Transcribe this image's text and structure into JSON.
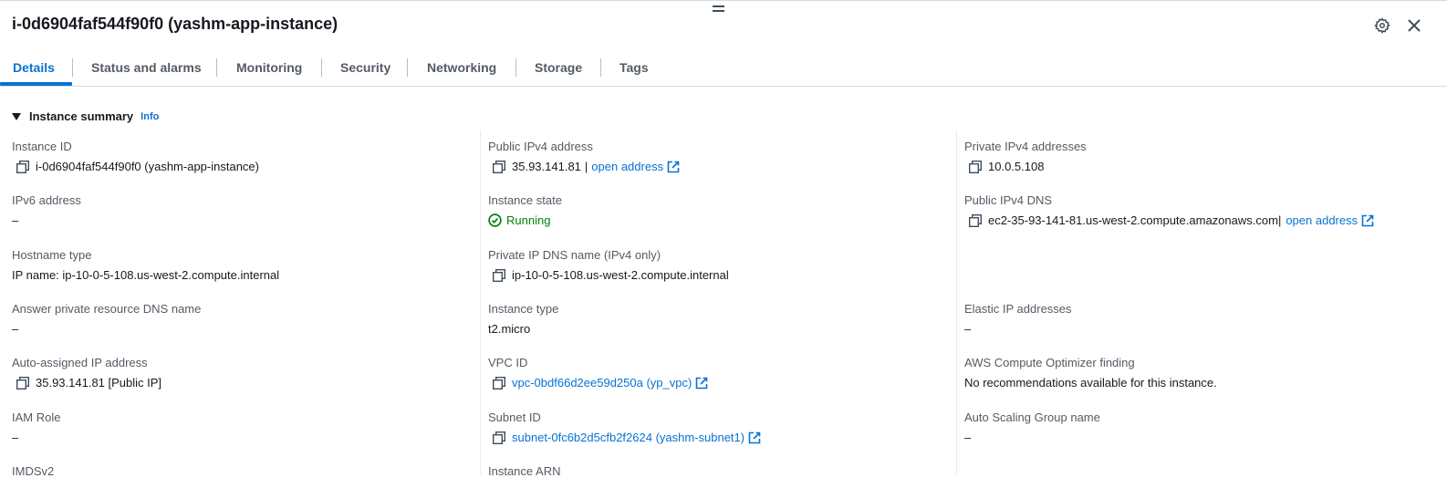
{
  "header": {
    "title": "i-0d6904faf544f90f0 (yashm-app-instance)",
    "icons": [
      "gear-icon",
      "close-icon",
      "drag-handle-icon"
    ]
  },
  "tabs": [
    {
      "label": "Details",
      "active": true
    },
    {
      "label": "Status and alarms"
    },
    {
      "label": "Monitoring"
    },
    {
      "label": "Security"
    },
    {
      "label": "Networking"
    },
    {
      "label": "Storage"
    },
    {
      "label": "Tags"
    }
  ],
  "section": {
    "title": "Instance summary",
    "info": "Info"
  },
  "fields": {
    "instance_id": {
      "label": "Instance ID",
      "value": "i-0d6904faf544f90f0 (yashm-app-instance)"
    },
    "ipv6": {
      "label": "IPv6 address",
      "value": "–"
    },
    "hostname_type": {
      "label": "Hostname type",
      "value": "IP name: ip-10-0-5-108.us-west-2.compute.internal"
    },
    "answer_dns": {
      "label": "Answer private resource DNS name",
      "value": "–"
    },
    "auto_ip": {
      "label": "Auto-assigned IP address",
      "value": "35.93.141.81 [Public IP]"
    },
    "iam_role": {
      "label": "IAM Role",
      "value": "–"
    },
    "imds": {
      "label": "IMDSv2"
    },
    "public_ipv4": {
      "label": "Public IPv4 address",
      "value": "35.93.141.81",
      "sep": "|",
      "link": "open address"
    },
    "instance_state": {
      "label": "Instance state",
      "value": "Running",
      "status_color": "#037f0c"
    },
    "private_dns": {
      "label": "Private IP DNS name (IPv4 only)",
      "value": "ip-10-0-5-108.us-west-2.compute.internal"
    },
    "instance_type": {
      "label": "Instance type",
      "value": "t2.micro"
    },
    "vpc_id": {
      "label": "VPC ID",
      "value": "vpc-0bdf66d2ee59d250a (yp_vpc)"
    },
    "subnet_id": {
      "label": "Subnet ID",
      "value": "subnet-0fc6b2d5cfb2f2624 (yashm-subnet1)"
    },
    "instance_arn": {
      "label": "Instance ARN"
    },
    "private_ipv4": {
      "label": "Private IPv4 addresses",
      "value": "10.0.5.108"
    },
    "public_dns": {
      "label": "Public IPv4 DNS",
      "value": "ec2-35-93-141-81.us-west-2.compute.amazonaws.com",
      "sep": "|",
      "link": "open address"
    },
    "elastic_ip": {
      "label": "Elastic IP addresses",
      "value": "–"
    },
    "optimizer": {
      "label": "AWS Compute Optimizer finding",
      "value": "No recommendations available for this instance."
    },
    "asg": {
      "label": "Auto Scaling Group name",
      "value": "–"
    }
  },
  "colors": {
    "accent": "#0972d3",
    "running": "#037f0c",
    "label": "#545b64",
    "text": "#16191f"
  }
}
